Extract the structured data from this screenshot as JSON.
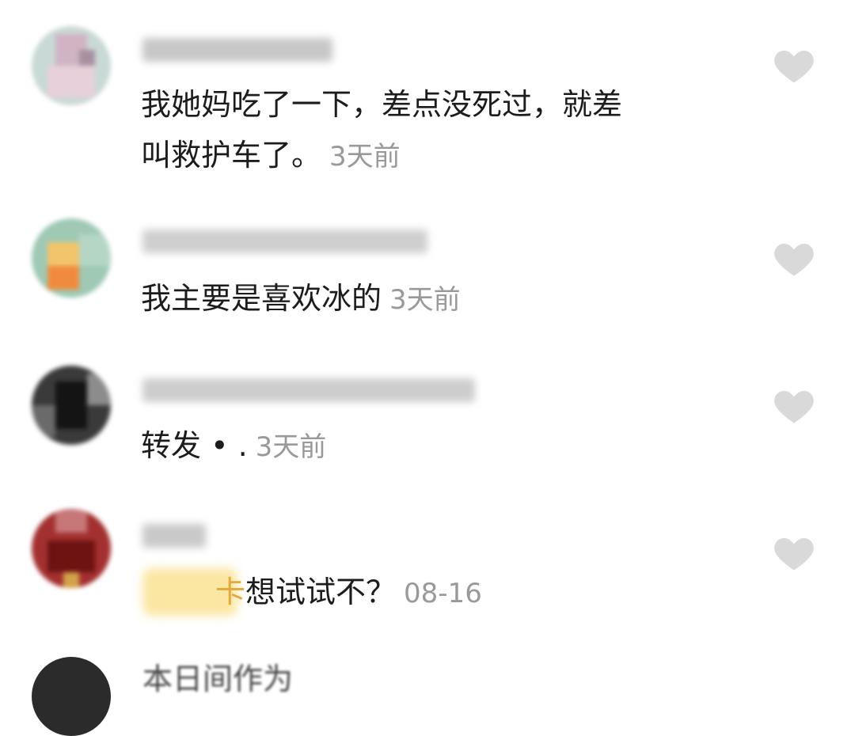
{
  "comments": [
    {
      "text": "我她妈吃了一下，差点没死过，就差\n叫救护车了。",
      "time": "3天前",
      "colors": [
        "#9fd3c7",
        "#c8b8c2",
        "#e9cfd9",
        "#b7a4b3"
      ]
    },
    {
      "text": "我主要是喜欢冰的",
      "time": "3天前",
      "colors": [
        "#8fc3a5",
        "#f4b860",
        "#f08b3d",
        "#a8cfb7"
      ]
    },
    {
      "text": "转发 • .",
      "time": "3天前",
      "colors": [
        "#1c1c1c",
        "#3f3f3f",
        "#5a5a5a",
        "#2a2a2a"
      ]
    },
    {
      "prefix": "卡",
      "text": "想试试不？",
      "time": "08-16",
      "colors": [
        "#8a1e1e",
        "#b33a3a",
        "#5a0f0f",
        "#c77777"
      ]
    }
  ],
  "partial_name": "本日间作为"
}
